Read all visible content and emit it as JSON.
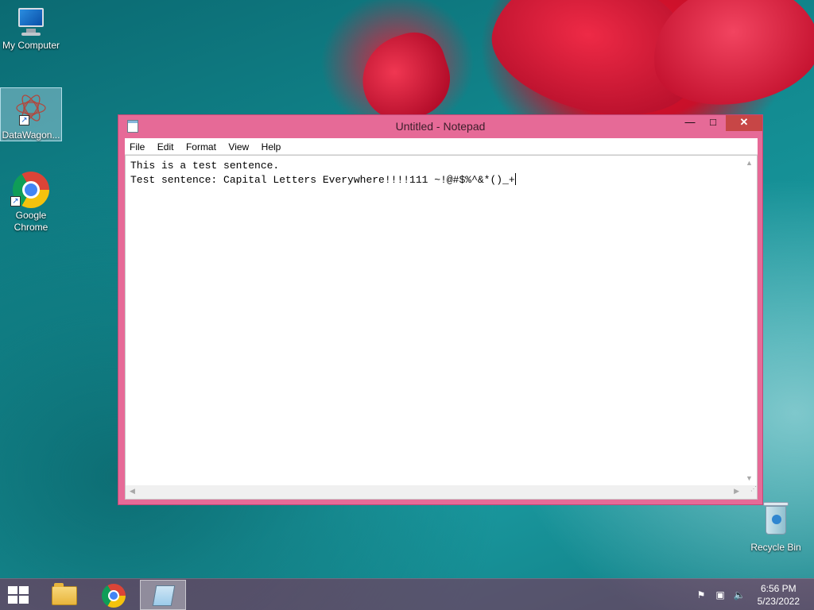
{
  "desktop": {
    "icons": [
      {
        "label": "My Computer",
        "icon": "monitor-icon"
      },
      {
        "label": "DataWagon...",
        "icon": "datawagon-icon"
      },
      {
        "label": "Google Chrome",
        "icon": "chrome-icon"
      }
    ],
    "recycle_bin": {
      "label": "Recycle Bin",
      "icon": "recycle-bin-icon"
    }
  },
  "window": {
    "title": "Untitled - Notepad",
    "controls": {
      "minimize": "—",
      "maximize": "□",
      "close": "✕"
    },
    "menu": [
      "File",
      "Edit",
      "Format",
      "View",
      "Help"
    ],
    "text_lines": [
      "This is a test sentence.",
      "Test sentence: Capital Letters Everywhere!!!!111 ~!@#$%^&*()_+"
    ]
  },
  "taskbar": {
    "items": [
      {
        "name": "start",
        "icon": "windows-logo-icon"
      },
      {
        "name": "file-explorer",
        "icon": "folder-icon"
      },
      {
        "name": "chrome",
        "icon": "chrome-icon"
      },
      {
        "name": "notepad",
        "icon": "notepad-icon",
        "active": true
      }
    ],
    "tray": [
      "flag-icon",
      "network-icon",
      "volume-muted-icon"
    ],
    "time": "6:56 PM",
    "date": "5/23/2022"
  },
  "colors": {
    "window_frame": "#e66a97",
    "close_button": "#c74646",
    "taskbar": "#8c2850"
  }
}
